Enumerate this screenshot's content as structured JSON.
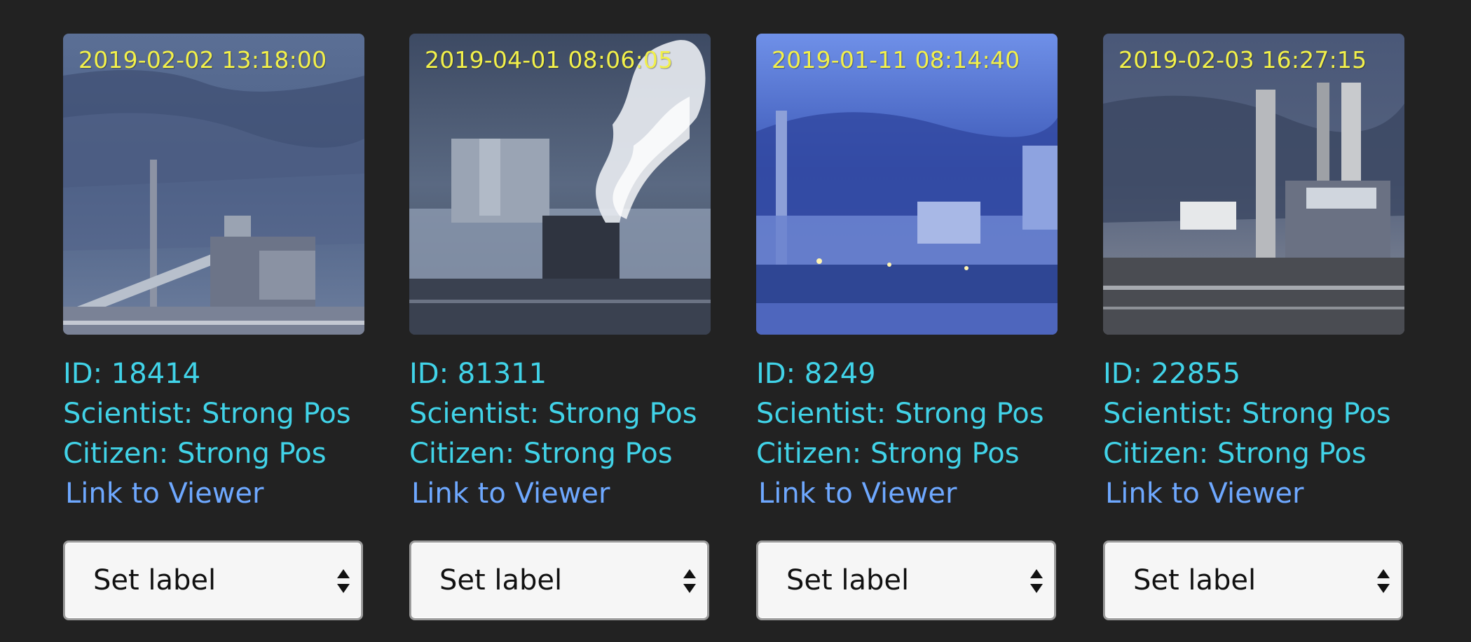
{
  "link_color": "#6ea8ff",
  "info_color": "#41d3e8",
  "cards": [
    {
      "timestamp": "2019-02-02 13:18:00",
      "id_text": "ID: 18414",
      "scientist_text": "Scientist: Strong Pos",
      "citizen_text": "Citizen: Strong Pos",
      "link_text": "Link to Viewer",
      "select_value": "Set label"
    },
    {
      "timestamp": "2019-04-01 08:06:05",
      "id_text": "ID: 81311",
      "scientist_text": "Scientist: Strong Pos",
      "citizen_text": "Citizen: Strong Pos",
      "link_text": "Link to Viewer",
      "select_value": "Set label"
    },
    {
      "timestamp": "2019-01-11 08:14:40",
      "id_text": "ID: 8249",
      "scientist_text": "Scientist: Strong Pos",
      "citizen_text": "Citizen: Strong Pos",
      "link_text": "Link to Viewer",
      "select_value": "Set label"
    },
    {
      "timestamp": "2019-02-03 16:27:15",
      "id_text": "ID: 22855",
      "scientist_text": "Scientist: Strong Pos",
      "citizen_text": "Citizen: Strong Pos",
      "link_text": "Link to Viewer",
      "select_value": "Set label"
    }
  ]
}
